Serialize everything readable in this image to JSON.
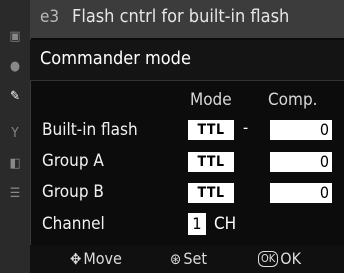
{
  "header": {
    "code": "e3",
    "title": "Flash cntrl for built-in flash"
  },
  "selected_option": "Commander mode",
  "columns": {
    "mode": "Mode",
    "comp": "Comp."
  },
  "rows": [
    {
      "label": "Built-in flash",
      "mode": "TTL",
      "separator": "-",
      "comp": "0"
    },
    {
      "label": "Group A",
      "mode": "TTL",
      "comp": "0"
    },
    {
      "label": "Group B",
      "mode": "TTL",
      "comp": "0"
    }
  ],
  "channel": {
    "label": "Channel",
    "value": "1",
    "unit": "CH"
  },
  "footer": {
    "move": "Move",
    "set": "Set",
    "ok_badge": "OK",
    "ok": "OK"
  },
  "sidebar_icons": [
    "playback-menu-icon",
    "shooting-menu-icon",
    "custom-settings-icon",
    "setup-menu-icon",
    "retouch-menu-icon",
    "recent-settings-icon"
  ]
}
